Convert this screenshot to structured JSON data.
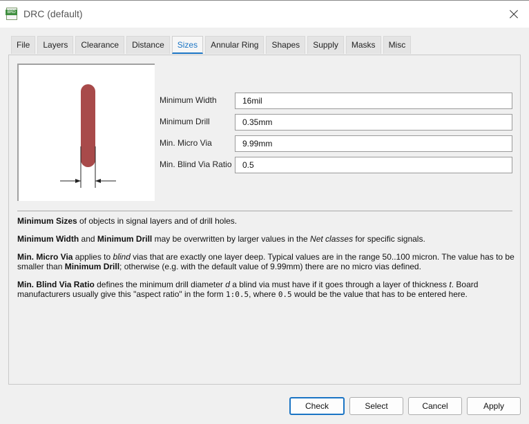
{
  "window": {
    "title": "DRC (default)",
    "icon_label": "BRD"
  },
  "tabs": [
    {
      "label": "File"
    },
    {
      "label": "Layers"
    },
    {
      "label": "Clearance"
    },
    {
      "label": "Distance"
    },
    {
      "label": "Sizes",
      "active": true
    },
    {
      "label": "Annular Ring"
    },
    {
      "label": "Shapes"
    },
    {
      "label": "Supply"
    },
    {
      "label": "Masks"
    },
    {
      "label": "Misc"
    }
  ],
  "form": {
    "min_width": {
      "label": "Minimum Width",
      "value": "16mil"
    },
    "min_drill": {
      "label": "Minimum Drill",
      "value": "0.35mm"
    },
    "min_micro_via": {
      "label": "Min. Micro Via",
      "value": "9.99mm"
    },
    "min_blind_via_ratio": {
      "label": "Min. Blind Via Ratio",
      "value": "0.5"
    }
  },
  "help": {
    "p1": {
      "b1": "Minimum Sizes",
      "t1": " of objects in signal layers and of drill holes."
    },
    "p2": {
      "b1": "Minimum Width",
      "t1": " and ",
      "b2": "Minimum Drill",
      "t2": " may be overwritten by larger values in the ",
      "i1": "Net classes",
      "t3": " for specific signals."
    },
    "p3": {
      "b1": "Min. Micro Via",
      "t1": " applies to ",
      "i1": "blind",
      "t2": " vias that are exactly one layer deep. Typical values are in the range 50..100 micron. The value has to be smaller than ",
      "b2": "Minimum Drill",
      "t3": "; otherwise (e.g. with the default value of 9.99mm) there are no micro vias defined."
    },
    "p4": {
      "b1": "Min. Blind Via Ratio",
      "t1": " defines the minimum drill diameter ",
      "i1": "d",
      "t2": " a blind via must have if it goes through a layer of thickness ",
      "i2": "t",
      "t3": ". Board manufacturers usually give this \"aspect ratio\" in the form ",
      "m1": "1:0.5",
      "t4": ", where ",
      "m2": "0.5",
      "t5": " would be the value that has to be entered here."
    }
  },
  "buttons": {
    "check": "Check",
    "select": "Select",
    "cancel": "Cancel",
    "apply": "Apply"
  },
  "colors": {
    "accent": "#1a74c4",
    "trace": "#a84a4a"
  }
}
